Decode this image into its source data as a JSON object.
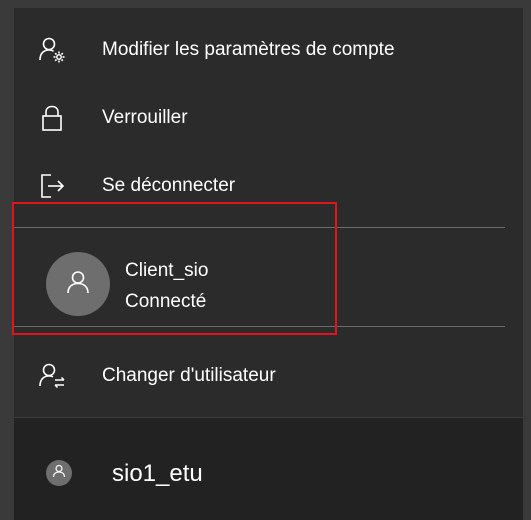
{
  "menu": {
    "items": [
      {
        "label": "Modifier les paramètres de compte",
        "icon": "account-settings-icon"
      },
      {
        "label": "Verrouiller",
        "icon": "lock-icon"
      },
      {
        "label": "Se déconnecter",
        "icon": "sign-out-icon"
      }
    ],
    "current_user": {
      "name": "Client_sio",
      "status": "Connecté",
      "avatar_icon": "user-avatar-icon"
    },
    "switch_user": {
      "label": "Changer d'utilisateur",
      "icon": "switch-user-icon"
    }
  },
  "other_user": {
    "name": "sio1_etu",
    "avatar_icon": "user-avatar-icon"
  },
  "colors": {
    "background": "#2b2b2b",
    "text": "#ffffff",
    "highlight": "#e0141e",
    "avatar": "#6e6e6e"
  }
}
